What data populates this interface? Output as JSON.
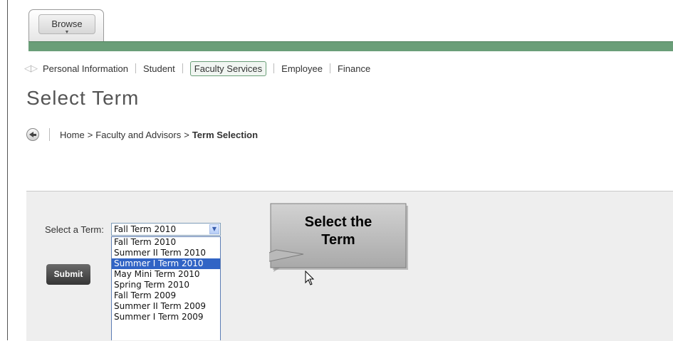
{
  "top": {
    "browse_label": "Browse"
  },
  "nav": {
    "items": [
      {
        "label": "Personal Information"
      },
      {
        "label": "Student"
      },
      {
        "label": "Faculty Services"
      },
      {
        "label": "Employee"
      },
      {
        "label": "Finance"
      }
    ],
    "active_index": 2
  },
  "page": {
    "title": "Select Term"
  },
  "breadcrumb": {
    "home": "Home",
    "sep": ">",
    "level2": "Faculty and Advisors",
    "current": "Term Selection"
  },
  "form": {
    "label": "Select a Term:",
    "selected_value": "Fall Term 2010",
    "options": [
      "Fall Term 2010",
      "Summer II Term 2010",
      "Summer I Term 2010",
      "May Mini Term 2010",
      "Spring Term 2010",
      "Fall Term 2009",
      "Summer II Term 2009",
      "Summer I Term 2009"
    ],
    "highlighted_option": "Summer I Term 2010",
    "submit_label": "Submit"
  },
  "callout": {
    "line1": "Select the",
    "line2": "Term"
  },
  "colors": {
    "accent_green": "#6a9e78",
    "highlight_blue": "#3164c5",
    "panel_gray": "#eeeeee"
  },
  "icons": [
    "back-arrow-icon",
    "nav-arrows-icon",
    "dropdown-arrow-icon",
    "mouse-cursor-icon"
  ]
}
